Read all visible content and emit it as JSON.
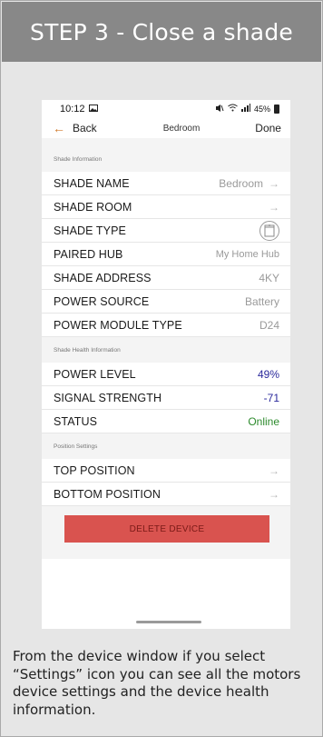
{
  "header": {
    "title": "STEP 3 - Close a shade"
  },
  "status_bar": {
    "time": "10:12",
    "battery": "45%",
    "left_icon": "image-icon",
    "right_icons": [
      "mute-icon",
      "wifi-icon",
      "signal-icon",
      "battery-icon"
    ]
  },
  "nav": {
    "back_label": "Back",
    "title": "Bedroom",
    "done_label": "Done"
  },
  "sections": {
    "shade_info": {
      "label": "Shade Information",
      "rows": [
        {
          "label": "SHADE NAME",
          "value": "Bedroom"
        },
        {
          "label": "SHADE ROOM",
          "value": ""
        },
        {
          "label": "SHADE TYPE",
          "value": ""
        },
        {
          "label": "PAIRED HUB",
          "value": "My Home Hub"
        },
        {
          "label": "SHADE ADDRESS",
          "value": "4KY"
        },
        {
          "label": "POWER SOURCE",
          "value": "Battery"
        },
        {
          "label": "POWER MODULE TYPE",
          "value": "D24"
        }
      ]
    },
    "health": {
      "label": "Shade Health Information",
      "rows": [
        {
          "label": "POWER LEVEL",
          "value": "49%"
        },
        {
          "label": "SIGNAL STRENGTH",
          "value": "-71"
        },
        {
          "label": "STATUS",
          "value": "Online"
        }
      ]
    },
    "position": {
      "label": "Position Settings",
      "rows": [
        {
          "label": "TOP POSITION",
          "value": ""
        },
        {
          "label": "BOTTOM POSITION",
          "value": ""
        }
      ]
    }
  },
  "delete_label": "DELETE DEVICE",
  "caption": "From the device window if you select “Settings” icon you can see all the motors device settings and the device health information.",
  "colors": {
    "header_bg": "#888888",
    "accent_orange": "#d07a2a",
    "value_blue": "#2b2a9c",
    "status_green": "#2c8a2c",
    "delete_red": "#d9534f"
  }
}
